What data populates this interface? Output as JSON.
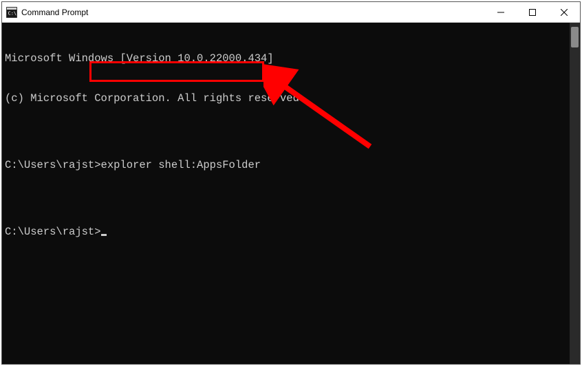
{
  "window": {
    "title": "Command Prompt"
  },
  "terminal": {
    "line1": "Microsoft Windows [Version 10.0.22000.434]",
    "line2": "(c) Microsoft Corporation. All rights reserved.",
    "blank1": "",
    "prompt1_prefix": "C:\\Users\\rajst>",
    "prompt1_cmd": "explorer shell:AppsFolder",
    "blank2": "",
    "prompt2_prefix": "C:\\Users\\rajst>"
  },
  "annotation": {
    "highlight_color": "#ff0000"
  }
}
